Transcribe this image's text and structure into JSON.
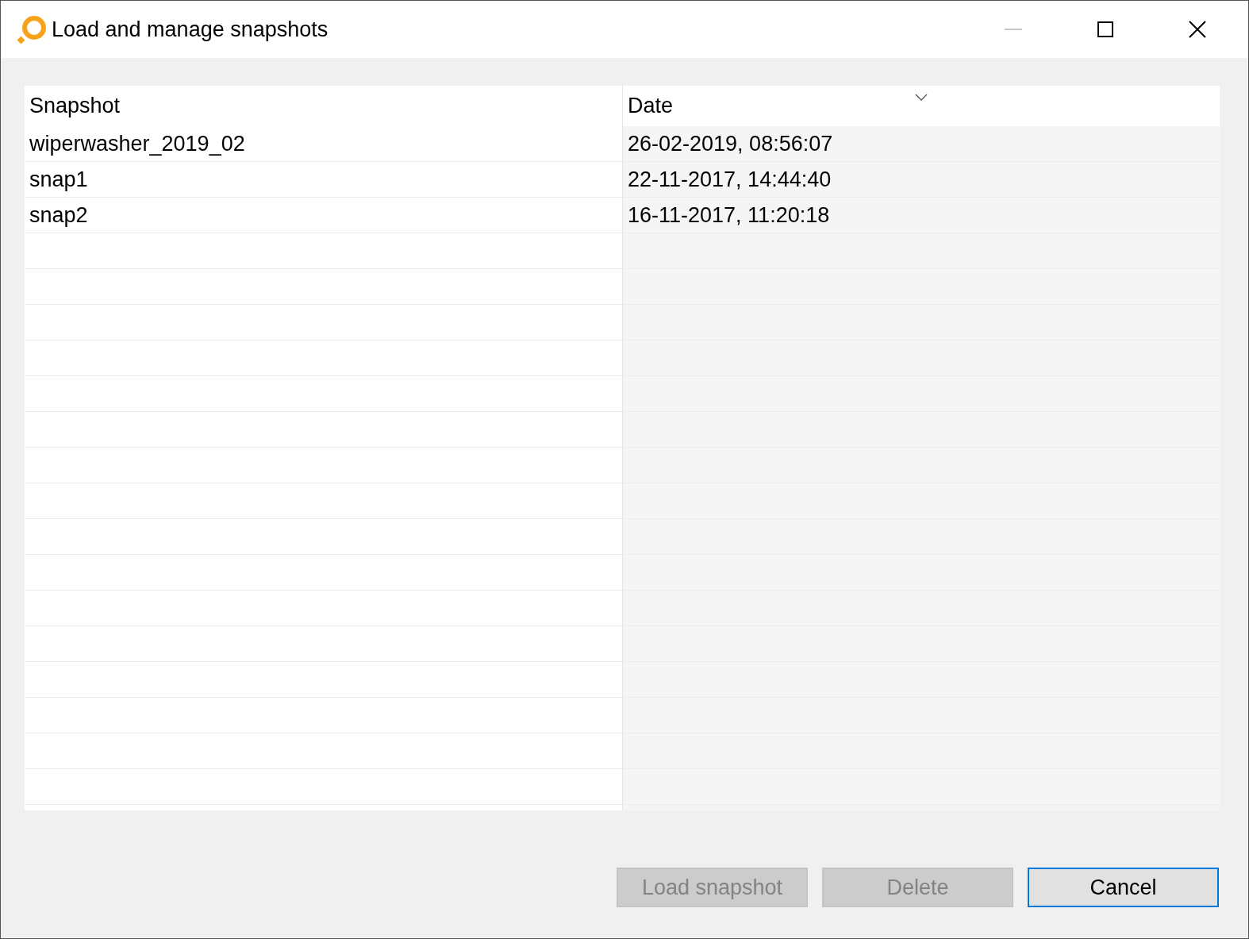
{
  "window": {
    "title": "Load and manage snapshots"
  },
  "table": {
    "columns": [
      {
        "label": "Snapshot",
        "sorted": false
      },
      {
        "label": "Date",
        "sorted": true
      }
    ],
    "rows": [
      {
        "cells": [
          "wiperwasher_2019_02",
          "26-02-2019, 08:56:07"
        ]
      },
      {
        "cells": [
          "snap1",
          "22-11-2017, 14:44:40"
        ]
      },
      {
        "cells": [
          "snap2",
          "16-11-2017, 11:20:18"
        ]
      }
    ]
  },
  "buttons": [
    {
      "label": "Load snapshot",
      "disabled": true,
      "default": false
    },
    {
      "label": "Delete",
      "disabled": true,
      "default": false
    },
    {
      "label": "Cancel",
      "disabled": false,
      "default": true
    }
  ]
}
